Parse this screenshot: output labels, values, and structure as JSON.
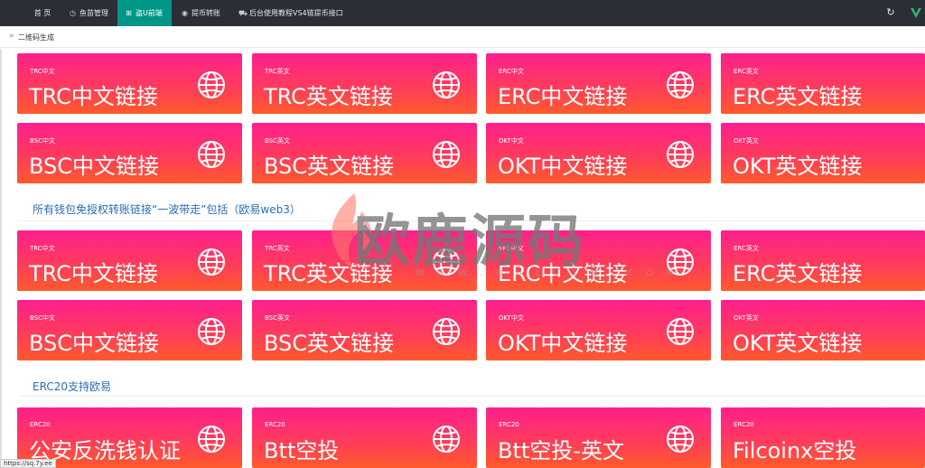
{
  "topnav": {
    "items": [
      {
        "label": "首 页",
        "icon": "none"
      },
      {
        "label": "鱼苗管理",
        "icon": "clock-icon"
      },
      {
        "label": "盗U前端",
        "icon": "windows-icon"
      },
      {
        "label": "提币转账",
        "icon": "target-icon"
      },
      {
        "label": "后台使用教程VS4链提币接口",
        "icon": "truck-icon"
      }
    ],
    "active_index": 2,
    "refresh_icon": "refresh-icon",
    "logo_icon": "v-logo-icon"
  },
  "breadcrumb": {
    "label": "二维码生成"
  },
  "sections": [
    {
      "title": "",
      "cards": [
        {
          "tag": "TRC中文",
          "title": "TRC中文链接"
        },
        {
          "tag": "TRC英文",
          "title": "TRC英文链接"
        },
        {
          "tag": "ERC中文",
          "title": "ERC中文链接"
        },
        {
          "tag": "ERC英文",
          "title": "ERC英文链接"
        },
        {
          "tag": "BSC中文",
          "title": "BSC中文链接"
        },
        {
          "tag": "BSC英文",
          "title": "BSC英文链接"
        },
        {
          "tag": "OKT中文",
          "title": "OKT中文链接"
        },
        {
          "tag": "OKT英文",
          "title": "OKT英文链接"
        }
      ]
    },
    {
      "title": "所有钱包免授权转账链接“一波带走”包括（欧易web3）",
      "cards": [
        {
          "tag": "TRC中文",
          "title": "TRC中文链接"
        },
        {
          "tag": "TRC英文",
          "title": "TRC英文链接"
        },
        {
          "tag": "ERC中文",
          "title": "ERC中文链接"
        },
        {
          "tag": "ERC英文",
          "title": "ERC英文链接"
        },
        {
          "tag": "BSC中文",
          "title": "BSC中文链接"
        },
        {
          "tag": "BSC英文",
          "title": "BSC英文链接"
        },
        {
          "tag": "OKT中文",
          "title": "OKT中文链接"
        },
        {
          "tag": "OKT英文",
          "title": "OKT英文链接"
        }
      ]
    },
    {
      "title": "ERC20支持欧易",
      "cards": [
        {
          "tag": "ERC20",
          "title": "公安反洗钱认证"
        },
        {
          "tag": "ERC20",
          "title": "Btt空投"
        },
        {
          "tag": "ERC20",
          "title": "Btt空投-英文"
        },
        {
          "tag": "ERC20",
          "title": "Filcoinx空投"
        }
      ]
    }
  ],
  "watermark": {
    "text": "欧鹿源码",
    "sub": "W W W . O U L U Y M . C O M"
  },
  "statusbar": {
    "url": "https://sq.7y.ee"
  },
  "colors": {
    "topbar": "#2b2e37",
    "active_tab": "#009688",
    "card_top": "#ff1f8e",
    "card_bottom": "#ff5a2c",
    "section_title": "#2a6db5"
  }
}
